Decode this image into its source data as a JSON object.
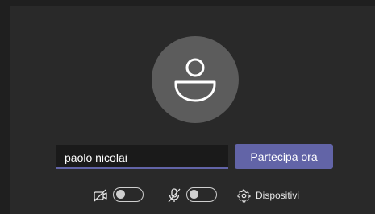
{
  "prejoin": {
    "name_value": "paolo nicolai",
    "name_placeholder": "",
    "join_label": "Partecipa ora",
    "camera": {
      "icon": "camera-off-icon",
      "enabled": false
    },
    "microphone": {
      "icon": "mic-off-icon",
      "enabled": false
    },
    "devices_label": "Dispositivi",
    "devices_icon": "gear-icon"
  },
  "colors": {
    "accent": "#6264a7",
    "background": "#292929",
    "avatar": "#5c5c5c"
  }
}
